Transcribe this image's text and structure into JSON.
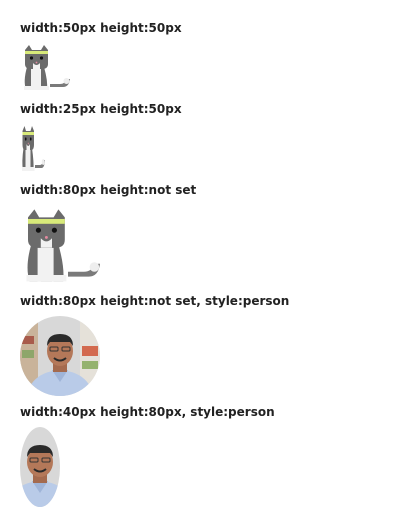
{
  "examples": [
    {
      "label": "width:50px height:50px",
      "image": "cat-icon"
    },
    {
      "label": "width:25px height:50px",
      "image": "cat-icon"
    },
    {
      "label": "width:80px height:not set",
      "image": "cat-icon"
    },
    {
      "label": "width:80px height:not set, style:person",
      "image": "person-photo"
    },
    {
      "label": "width:40px height:80px, style:person",
      "image": "person-photo"
    }
  ],
  "colors": {
    "cat_body": "#6b6b6b",
    "cat_chest": "#f2f2f2",
    "cat_headband": "#d8ea7a",
    "text": "#222222",
    "person_shirt": "#b9cbe8",
    "person_skin": "#b47859",
    "person_hair": "#2a2a2a",
    "background_wall": "#d8d8d8"
  }
}
